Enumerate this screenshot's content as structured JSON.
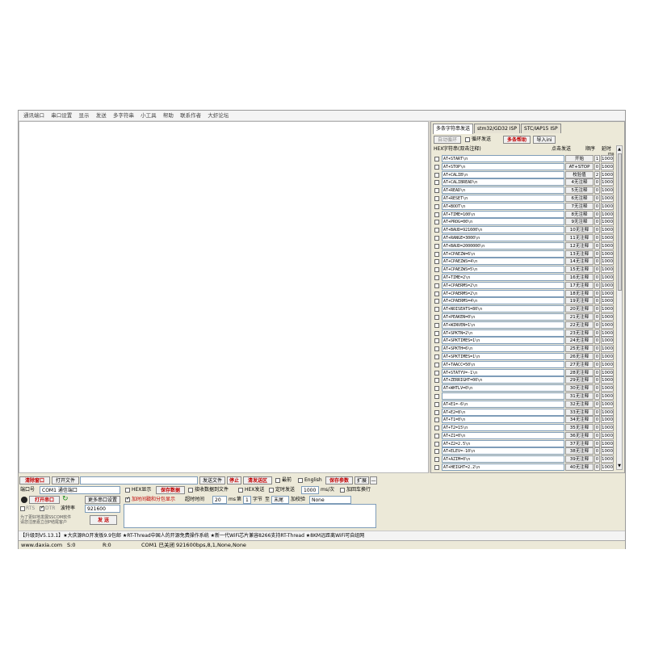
{
  "menu": [
    "通讯端口",
    "串口设置",
    "显示",
    "发送",
    "多字符串",
    "小工具",
    "帮助",
    "联系作者",
    "大虾论坛"
  ],
  "tabs": [
    "多条字符串发送",
    "stm32/GD32 ISP",
    "STC/IAP15 ISP"
  ],
  "panel": {
    "auto_loop": "循环发送",
    "auto_label": "自动循环",
    "help_btn": "多条帮助",
    "import_btn": "导入ini",
    "hdr_hex": "HEX",
    "hdr_str": "字符串(双击注释)",
    "hdr_click": "点击发送",
    "hdr_order": "顺序",
    "hdr_delay": "延时",
    "hdr_ms": "ms"
  },
  "rows": [
    {
      "cmd": "AT+START\\n",
      "btn": "开始",
      "ord": "1",
      "dly": "1000"
    },
    {
      "cmd": "AT+STOP\\n",
      "btn": "AT+STOP",
      "ord": "0",
      "dly": "1000"
    },
    {
      "cmd": "AT+CALIB\\n",
      "btn": "校验值",
      "ord": "2",
      "dly": "1000"
    },
    {
      "cmd": "AT+CALIBREAD\\n",
      "btn": "4无注释",
      "ord": "0",
      "dly": "1000"
    },
    {
      "cmd": "AT+READ\\n",
      "btn": "5无注释",
      "ord": "0",
      "dly": "1000"
    },
    {
      "cmd": "AT+RESET\\n",
      "btn": "6无注释",
      "ord": "0",
      "dly": "1000"
    },
    {
      "cmd": "AT+BOOT\\n",
      "btn": "7无注释",
      "ord": "0",
      "dly": "1000"
    },
    {
      "cmd": "AT+TIME=100\\n",
      "btn": "8无注释",
      "ord": "0",
      "dly": "1000"
    },
    {
      "cmd": "AT+PROG=00\\n",
      "btn": "9无注释",
      "ord": "0",
      "dly": "1000"
    },
    {
      "cmd": "AT+BAUD=921600\\n",
      "btn": "10无注释",
      "ord": "0",
      "dly": "1000"
    },
    {
      "cmd": "AT+RANGE=3000\\n",
      "btn": "11无注释",
      "ord": "0",
      "dly": "1000"
    },
    {
      "cmd": "AT+BAUD=2000000\\n",
      "btn": "12无注释",
      "ord": "0",
      "dly": "1000"
    },
    {
      "cmd": "AT+CPAEZW=6\\n",
      "btn": "13无注释",
      "ord": "0",
      "dly": "1000"
    },
    {
      "cmd": "AT+CPAEZWS=4\\n",
      "btn": "14无注释",
      "ord": "0",
      "dly": "1000"
    },
    {
      "cmd": "AT+CPAEZWS=5\\n",
      "btn": "15无注释",
      "ord": "0",
      "dly": "1000"
    },
    {
      "cmd": "AT+TIME=2\\n",
      "btn": "16无注释",
      "ord": "0",
      "dly": "1000"
    },
    {
      "cmd": "AT+CPAERMS=2\\n",
      "btn": "17无注释",
      "ord": "0",
      "dly": "1000"
    },
    {
      "cmd": "AT+CPAERMS=2\\n",
      "btn": "18无注释",
      "ord": "0",
      "dly": "1000"
    },
    {
      "cmd": "AT+CPAERMS=4\\n",
      "btn": "19无注释",
      "ord": "0",
      "dly": "1000"
    },
    {
      "cmd": "AT+NOISEATS=80\\n",
      "btn": "20无注释",
      "ord": "0",
      "dly": "1000"
    },
    {
      "cmd": "AT+PEAKEN=0\\n",
      "btn": "21无注释",
      "ord": "0",
      "dly": "1000"
    },
    {
      "cmd": "AT+WINVEN=1\\n",
      "btn": "22无注释",
      "ord": "0",
      "dly": "1000"
    },
    {
      "cmd": "AT+SPKTN=2\\n",
      "btn": "23无注释",
      "ord": "0",
      "dly": "1000"
    },
    {
      "cmd": "AT+SPKTIMES=1\\n",
      "btn": "24无注释",
      "ord": "0",
      "dly": "1000"
    },
    {
      "cmd": "AT+SPKTH=6\\n",
      "btn": "25无注释",
      "ord": "0",
      "dly": "1000"
    },
    {
      "cmd": "AT+SPKTIMES=1\\n",
      "btn": "26无注释",
      "ord": "0",
      "dly": "1000"
    },
    {
      "cmd": "AT+TAACC=50\\n",
      "btn": "27无注释",
      "ord": "0",
      "dly": "1000"
    },
    {
      "cmd": "AT+STATYV=-1\\n",
      "btn": "28无注释",
      "ord": "0",
      "dly": "1000"
    },
    {
      "cmd": "AT+ZERRIGHT=00\\n",
      "btn": "29无注释",
      "ord": "0",
      "dly": "1000"
    },
    {
      "cmd": "AT+WHTLV=0\\n",
      "btn": "30无注释",
      "ord": "0",
      "dly": "1000"
    },
    {
      "cmd": "",
      "btn": "31无注释",
      "ord": "0",
      "dly": "1000"
    },
    {
      "cmd": "AT+E1=-6\\n",
      "btn": "32无注释",
      "ord": "0",
      "dly": "1000"
    },
    {
      "cmd": "AT+E2=8\\n",
      "btn": "33无注释",
      "ord": "0",
      "dly": "1000"
    },
    {
      "cmd": "AT+T1=0\\n",
      "btn": "34无注释",
      "ord": "0",
      "dly": "1000"
    },
    {
      "cmd": "AT+T2=15\\n",
      "btn": "35无注释",
      "ord": "0",
      "dly": "1000"
    },
    {
      "cmd": "AT+Z1=0\\n",
      "btn": "36无注释",
      "ord": "0",
      "dly": "1000"
    },
    {
      "cmd": "AT+Z2=2.5\\n",
      "btn": "37无注释",
      "ord": "0",
      "dly": "1000"
    },
    {
      "cmd": "AT+ELEV=-10\\n",
      "btn": "38无注释",
      "ord": "0",
      "dly": "1000"
    },
    {
      "cmd": "AT+AZIM=0\\n",
      "btn": "39无注释",
      "ord": "0",
      "dly": "1000"
    },
    {
      "cmd": "AT+HEIGHT=2.2\\n",
      "btn": "40无注释",
      "ord": "0",
      "dly": "1000"
    }
  ],
  "bottom": {
    "clear_btn": "清除窗口",
    "open_file": "打开文件",
    "send_file": "发送文件",
    "stop": "停止",
    "send_area": "清发送区",
    "latest": "最前",
    "english": "English",
    "save_params": "保存参数",
    "expand": "扩展",
    "port_label": "端口号",
    "port_value": "COM1 通信端口",
    "hex_show": "HEX显示",
    "save_data": "保存数据",
    "recv_to_file": "接收数据到文件",
    "hex_send": "HEX发送",
    "timed_send": "定时发送",
    "period": "1000",
    "period_unit": "ms/次",
    "crlf": "加回车换行",
    "open_port": "打开串口",
    "more_settings": "更多串口设置",
    "timestamp": "加时间戳和分包显示",
    "timeout_label": "超时时间",
    "timeout": "20",
    "timeout_unit": "ms",
    "nth": "第",
    "byte_num": "1",
    "byte_label": "字节",
    "to": "至",
    "end": "末尾",
    "checksum": "加校验",
    "checksum_value": "None",
    "rts": "RTS",
    "dtr": "DTR",
    "baud_label": "波特率",
    "baud_value": "921600",
    "send_btn": "发 送",
    "promo": "为了更好地发展SSCOM软件 请您注册嘉立创P结尾客户"
  },
  "ticker": "【升级到V5.13.1】★大庆源RO开发板9.9包邮 ★RT-Thread中国人的开源免费操作系统 ★新一代WiFi芯片兼容8266支持RT-Thread ★8KM远距离WiFi可自组网",
  "status": {
    "site": "www.daxia.com",
    "s": "S:0",
    "r": "R:0",
    "info": "COM1 已关闭  921600bps,8,1,None,None"
  },
  "colors": {
    "accent_red": "#c00000",
    "led_black": "#222222",
    "refresh_green": "#1a8a1a"
  }
}
